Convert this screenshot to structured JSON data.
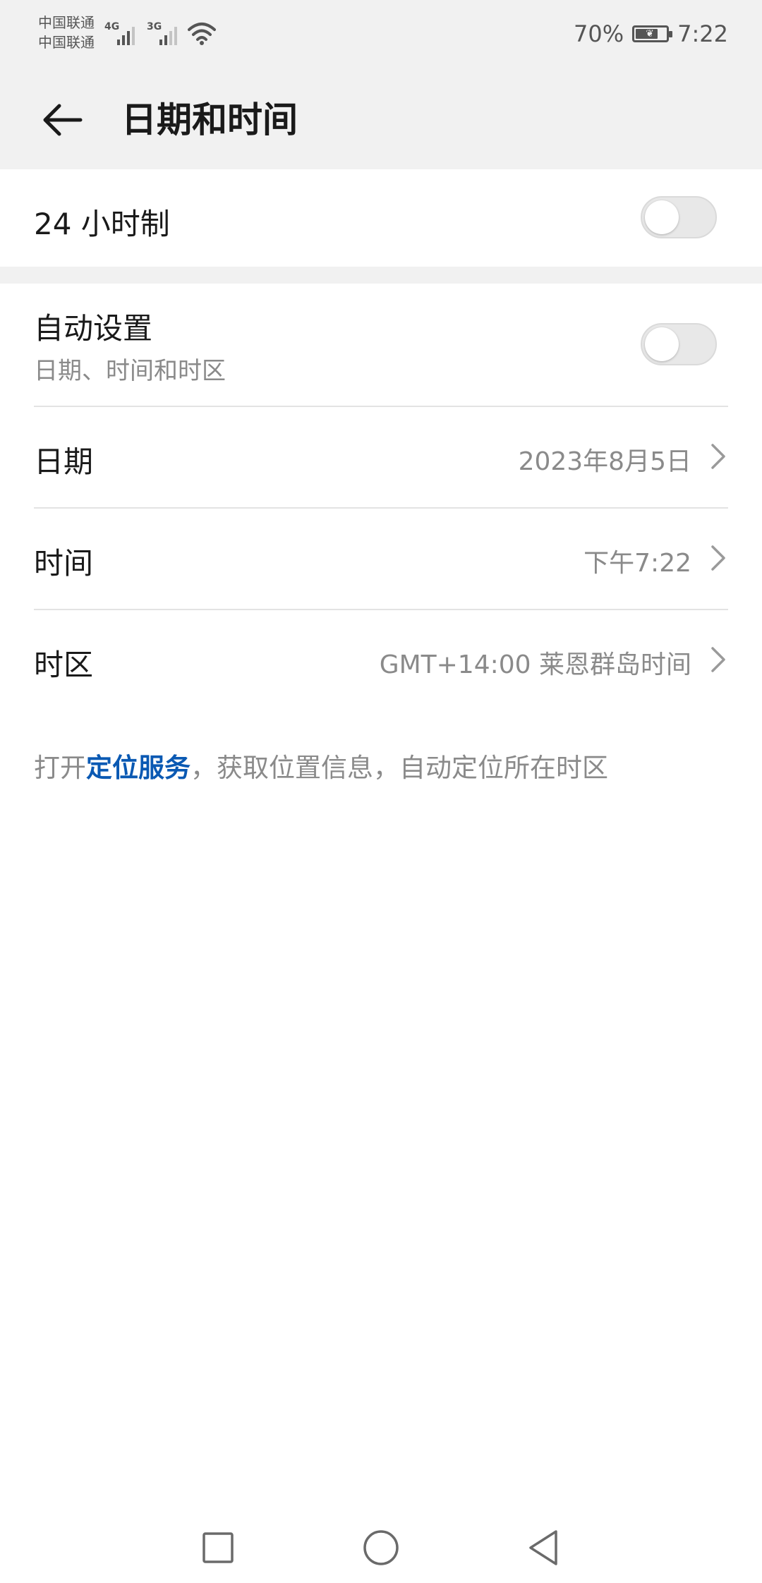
{
  "status_bar": {
    "carrier_1": "中国联通",
    "carrier_2": "中国联通",
    "network_1": "4G",
    "network_2": "3G",
    "battery_percent": "70%",
    "battery_level": 0.7,
    "time": "7:22",
    "icons": [
      "signal-icon",
      "wifi-icon",
      "battery-icon"
    ]
  },
  "app_bar": {
    "back_icon": "arrow-left-icon",
    "title": "日期和时间"
  },
  "settings": {
    "hour24": {
      "label": "24 小时制",
      "enabled": false
    },
    "auto": {
      "label": "自动设置",
      "sub": "日期、时间和时区",
      "enabled": false
    },
    "date": {
      "label": "日期",
      "value": "2023年8月5日"
    },
    "time": {
      "label": "时间",
      "value": "下午7:22"
    },
    "timezone": {
      "label": "时区",
      "value": "GMT+14:00 莱恩群岛时间"
    }
  },
  "hint": {
    "prefix": "打开",
    "link": "定位服务",
    "suffix": "，获取位置信息，自动定位所在时区"
  },
  "colors": {
    "accent_link": "#0a59b3",
    "header_bg": "#f1f1f1",
    "secondary_text": "#8a8a8a"
  },
  "nav_bar": {
    "recent_icon": "square-icon",
    "home_icon": "circle-icon",
    "back_icon": "triangle-back-icon"
  }
}
